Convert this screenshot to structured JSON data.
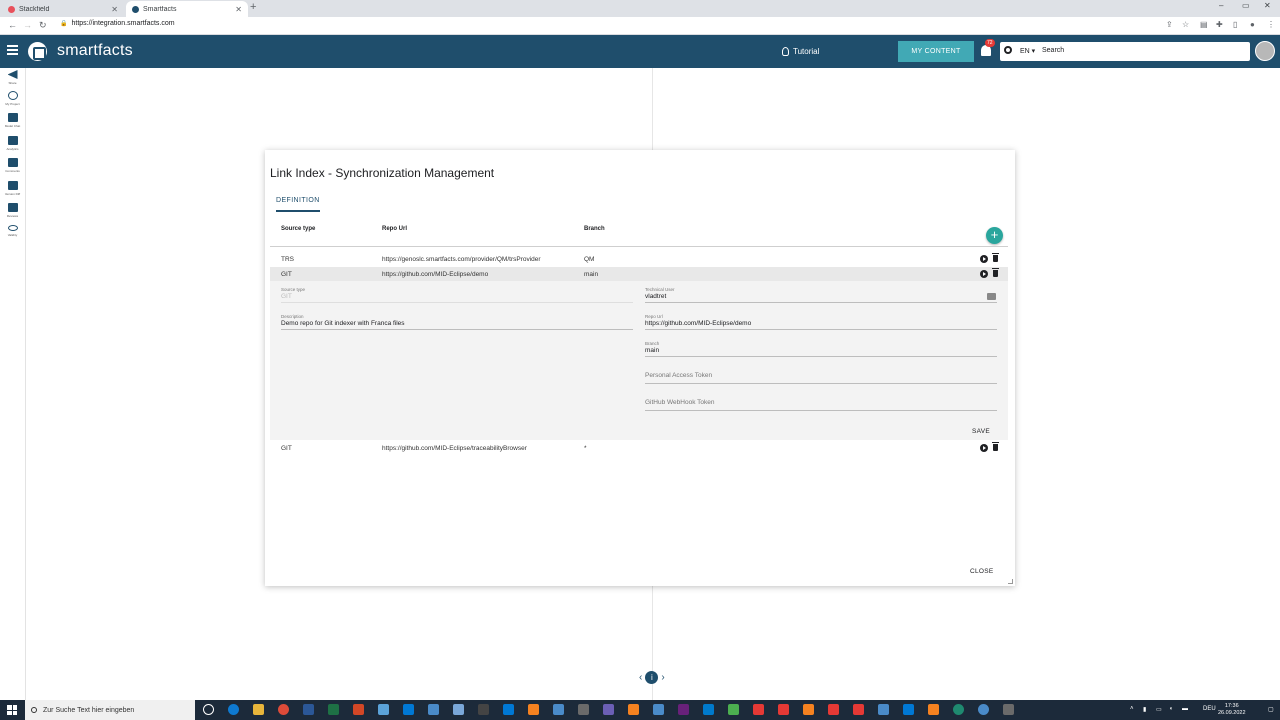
{
  "browser": {
    "tabs": [
      {
        "label": "Stackfield",
        "close": "✕"
      },
      {
        "label": "Smartfacts",
        "close": "✕"
      }
    ],
    "new_tab": "+",
    "url": "https://integration.smartfacts.com",
    "window_controls": [
      "–",
      "▭",
      "✕"
    ]
  },
  "header": {
    "logo_text": "smartfacts",
    "tutorial_label": "Tutorial",
    "my_content_label": "MY CONTENT",
    "notification_count": "72",
    "language": "EN ▾",
    "search_placeholder": "Search"
  },
  "rail": {
    "items": [
      {
        "label": "Share"
      },
      {
        "label": "My Project"
      },
      {
        "label": "Model Chat"
      },
      {
        "label": "Analytics"
      },
      {
        "label": "Comments"
      },
      {
        "label": "Version Diff"
      },
      {
        "label": "Reviews"
      },
      {
        "label": "Validity"
      }
    ]
  },
  "dialog": {
    "title": "Link Index - Synchronization Management",
    "tab_label": "DEFINITION",
    "columns": [
      "Source type",
      "Repo Url",
      "Branch"
    ],
    "add_button": "+",
    "rows": [
      {
        "source_type": "TRS",
        "repo_url": "https://genoslc.smartfacts.com/provider/QM/trsProvider",
        "branch": "QM"
      },
      {
        "source_type": "GIT",
        "repo_url": "https://github.com/MID-Eclipse/demo",
        "branch": "main"
      },
      {
        "source_type": "GIT",
        "repo_url": "https://github.com/MID-Eclipse/traceabilityBrowser",
        "branch": "*"
      }
    ],
    "detail": {
      "source_type_label": "Source type",
      "source_type_value": "GIT",
      "description_label": "Description",
      "description_value": "Demo repo for Git indexer with Franca files",
      "technical_user_label": "Technical User",
      "technical_user_value": "vladtret",
      "repo_url_label": "Repo Url",
      "repo_url_value": "https://github.com/MID-Eclipse/demo",
      "branch_label": "Branch",
      "branch_value": "main",
      "pat_placeholder": "Personal Access Token",
      "webhook_placeholder": "GitHub WebHook Token",
      "save_label": "SAVE"
    },
    "close_label": "CLOSE"
  },
  "pager": {
    "prev": "‹",
    "info": "i",
    "next": "›"
  },
  "taskbar": {
    "search_placeholder": "Zur Suche Text hier eingeben",
    "lang": "DEU",
    "time": "17:36",
    "date": "26.09.2022"
  },
  "colors": {
    "appbar": "#1f4e6c",
    "accent": "#41a9b5",
    "add_button": "#2aa69d",
    "badge": "#e53935"
  }
}
